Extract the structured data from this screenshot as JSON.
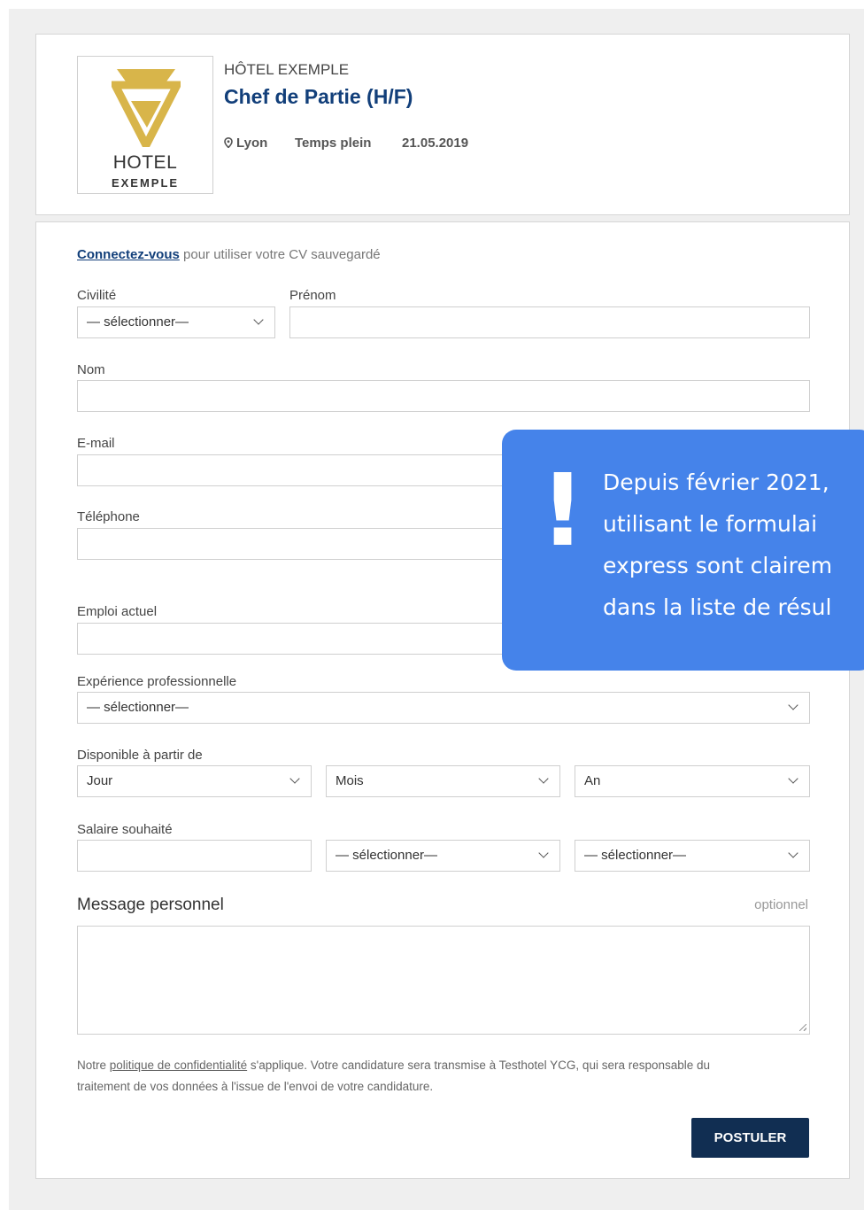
{
  "job": {
    "hotel_name": "HÔTEL EXEMPLE",
    "title": "Chef de Partie (H/F)",
    "location": "Lyon",
    "contract": "Temps plein",
    "date": "21.05.2019",
    "logo": {
      "line1": "HOTEL",
      "line2": "EXEMPLE",
      "color": "#d8b54a"
    }
  },
  "form": {
    "login_link": "Connectez-vous",
    "login_suffix": " pour utiliser votre CV sauvegardé",
    "civility_label": "Civilité",
    "civility_value": "— sélectionner—",
    "firstname_label": "Prénom",
    "lastname_label": "Nom",
    "email_label": "E-mail",
    "phone_label": "Téléphone",
    "current_job_label": "Emploi actuel",
    "experience_label": "Expérience professionnelle",
    "experience_value": "— sélectionner—",
    "available_label": "Disponible à partir de",
    "day_value": "Jour",
    "month_value": "Mois",
    "year_value": "An",
    "salary_label": "Salaire souhaité",
    "salary_select1": "— sélectionner—",
    "salary_select2": "— sélectionner—",
    "message_label": "Message personnel",
    "optional_label": "optionnel",
    "privacy_pre": "Notre ",
    "privacy_link": "politique de confidentialité",
    "privacy_post": " s'applique. Votre candidature sera transmise à Testhotel YCG, qui sera responsable du traitement de vos données à l'issue de l'envoi de votre candidature.",
    "submit_label": "POSTULER"
  },
  "notice": {
    "mark": "!",
    "lines": [
      "Depuis février 2021,",
      "utilisant le formulai",
      "express sont clairem",
      "dans la liste de résul"
    ],
    "color": "#4583ea"
  },
  "colors": {
    "brand": "#123f7a",
    "button": "#112e52"
  }
}
